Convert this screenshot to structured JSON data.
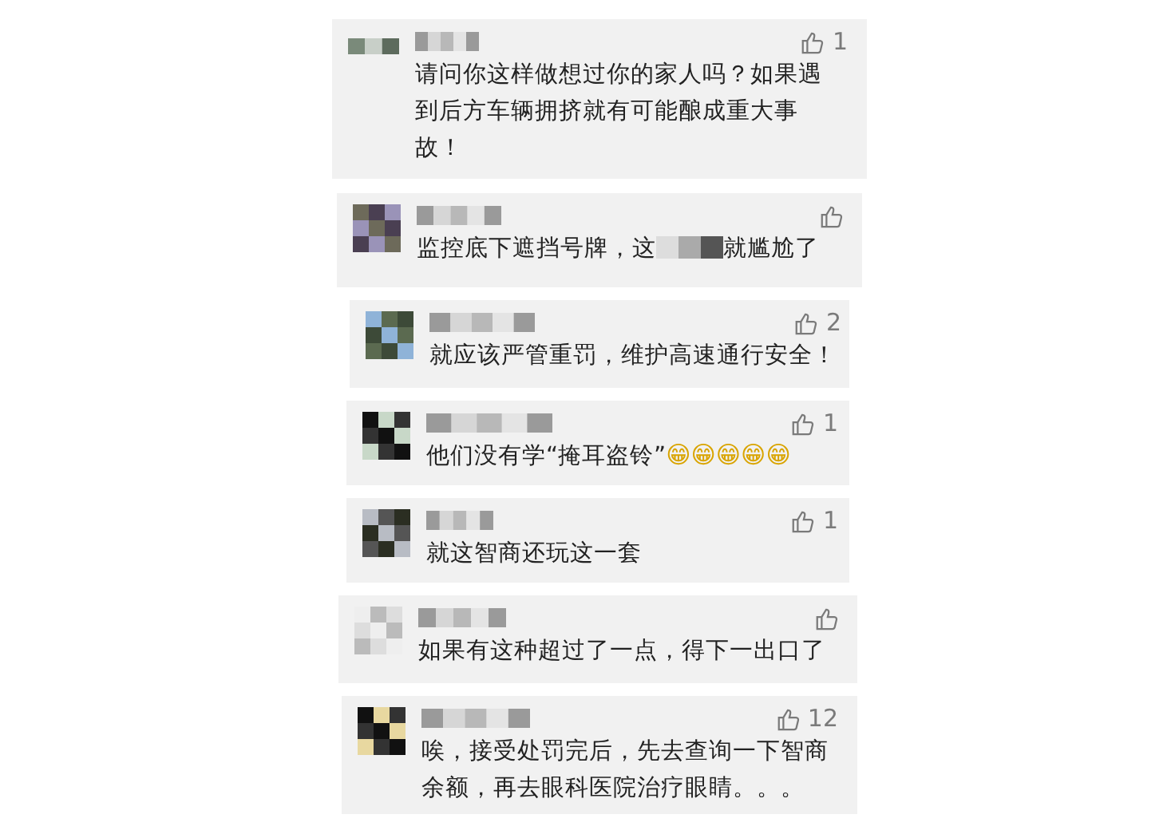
{
  "comments": [
    {
      "text": "请问你这样做想过你的家人吗？如果遇到后方车辆拥挤就有可能酿成重大事故！",
      "likes": "1"
    },
    {
      "text": "监控底下遮挡号牌，这",
      "text_after": "就尴尬了"
    },
    {
      "text": "就应该严管重罚，维护高速通行安全！",
      "likes": "2"
    },
    {
      "text": "他们没有学“掩耳盗铃”",
      "emojis": [
        "😁",
        "😁",
        "😁",
        "😁",
        "😁"
      ],
      "likes": "1"
    },
    {
      "text": "就这智商还玩这一套",
      "likes": "1"
    },
    {
      "text": "如果有这种超过了一点，得下一出口了"
    },
    {
      "text": "唉，接受处罚完后，先去查询一下智商余额，再去眼科医院治疗眼睛。。。",
      "likes": "12"
    }
  ]
}
